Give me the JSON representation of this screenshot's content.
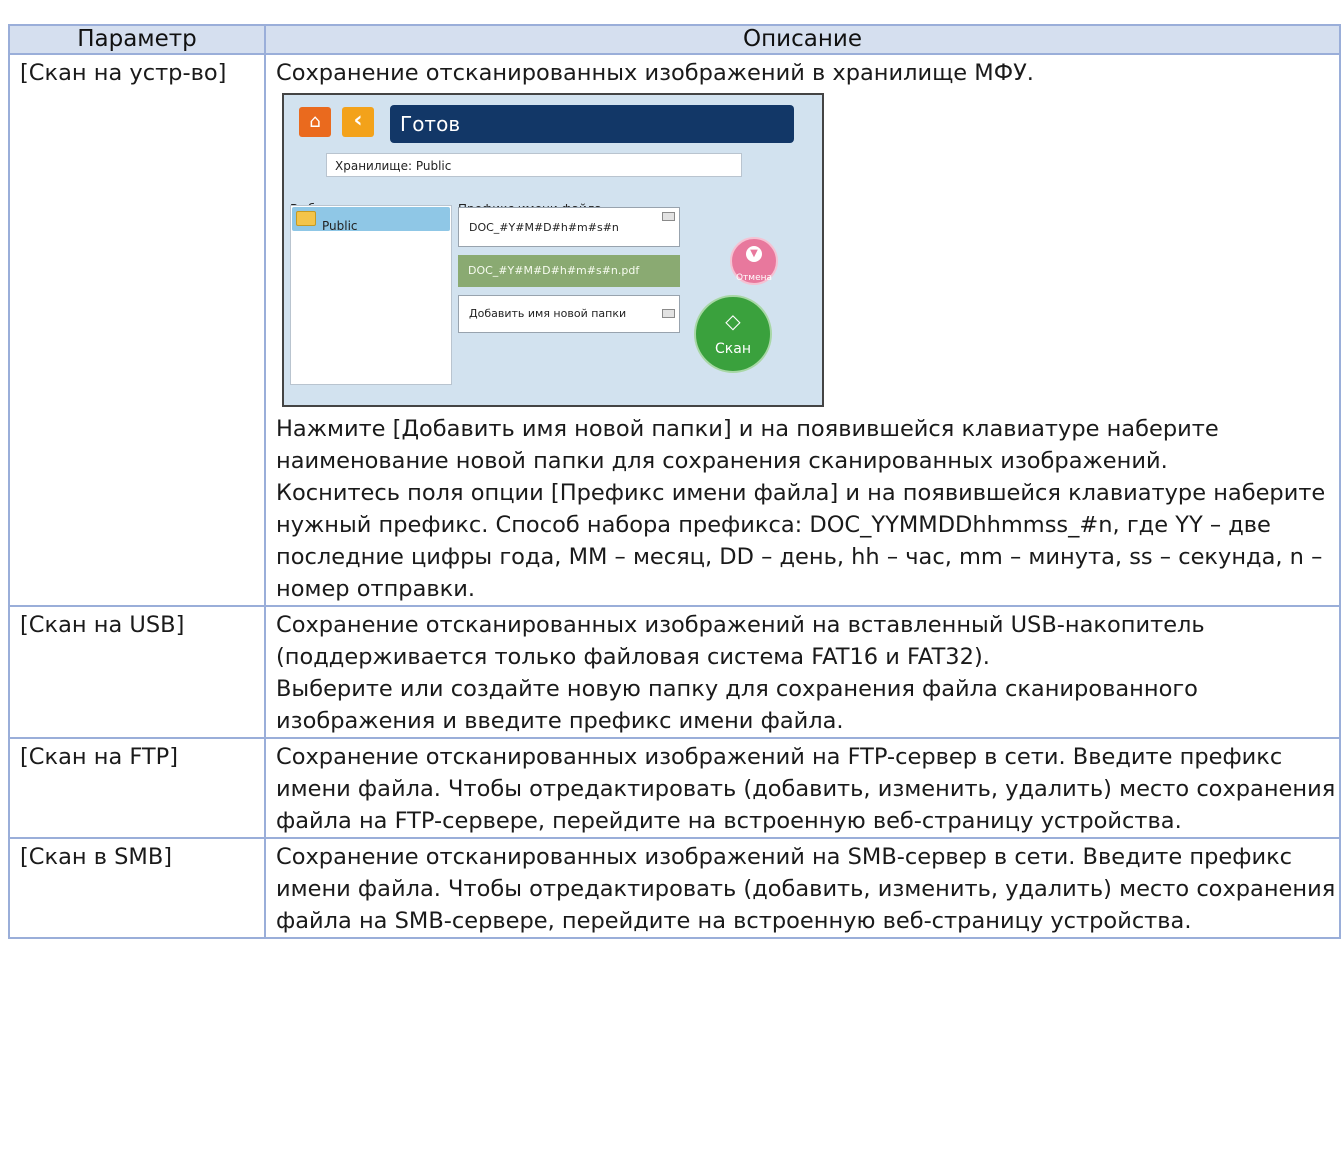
{
  "table": {
    "header": {
      "param": "Параметр",
      "desc": "Описание"
    },
    "rows": [
      {
        "param": "[Скан на устр-во]",
        "paragraphs": [
          "Сохранение отсканированных изображений в хранилище МФУ.",
          "Нажмите [Добавить имя новой папки] и на появившейся клавиатуре наберите наименование новой папки для сохранения сканированных изображений.",
          "Коснитесь поля опции [Префикс имени файла] и на появившейся клавиатуре наберите нужный префикс. Способ набора префикса: DOC_YYMMDDhhmmss_#n, где YY – две последние цифры года, MM – месяц, DD – день, hh – час, mm – минута, ss – секунда, n – номер отправки."
        ]
      },
      {
        "param": "[Скан на USB]",
        "paragraphs": [
          "Сохранение отсканированных изображений на вставленный USB-накопитель (поддерживается только файловая система FAT16 и FAT32).",
          "Выберите или создайте новую папку для сохранения файла сканированного изображения и введите префикс имени файла."
        ]
      },
      {
        "param": "[Скан на FTP]",
        "paragraphs": [
          "Сохранение отсканированных изображений на FTP-сервер в сети. Введите префикс имени файла. Чтобы отредактировать (добавить, изменить, удалить) место сохранения файла на FTP-сервере, перейдите на встроенную веб-страницу устройства."
        ]
      },
      {
        "param": "[Скан в SMB]",
        "paragraphs": [
          "Сохранение отсканированных изображений на SMB-сервер в сети. Введите префикс имени файла. Чтобы отредактировать (добавить, изменить, удалить) место сохранения файла на SMB-сервере, перейдите на встроенную веб-страницу устройства."
        ]
      }
    ]
  },
  "screen": {
    "title": "Готов",
    "storage": "Хранилище: Public",
    "folder_label": "Выберите папку",
    "folder_name": "Public",
    "prefix_label": "Префикс имени файла",
    "prefix_value": "DOC_#Y#M#D#h#m#s#n",
    "preview": "DOC_#Y#M#D#h#m#s#n.pdf",
    "new_folder": "Добавить имя новой папки",
    "cancel": "Отмена",
    "scan": "Скан",
    "icons": [
      "home-icon",
      "back-icon",
      "folder-icon",
      "keyboard-icon",
      "cancel-icon",
      "start-icon"
    ],
    "colors": {
      "title_bg": "#123767",
      "home": "#ea6a1e",
      "back": "#f3a21a",
      "scan": "#3aa13d",
      "cancel": "#e8789d",
      "screen_bg": "#d2e2ef"
    }
  }
}
